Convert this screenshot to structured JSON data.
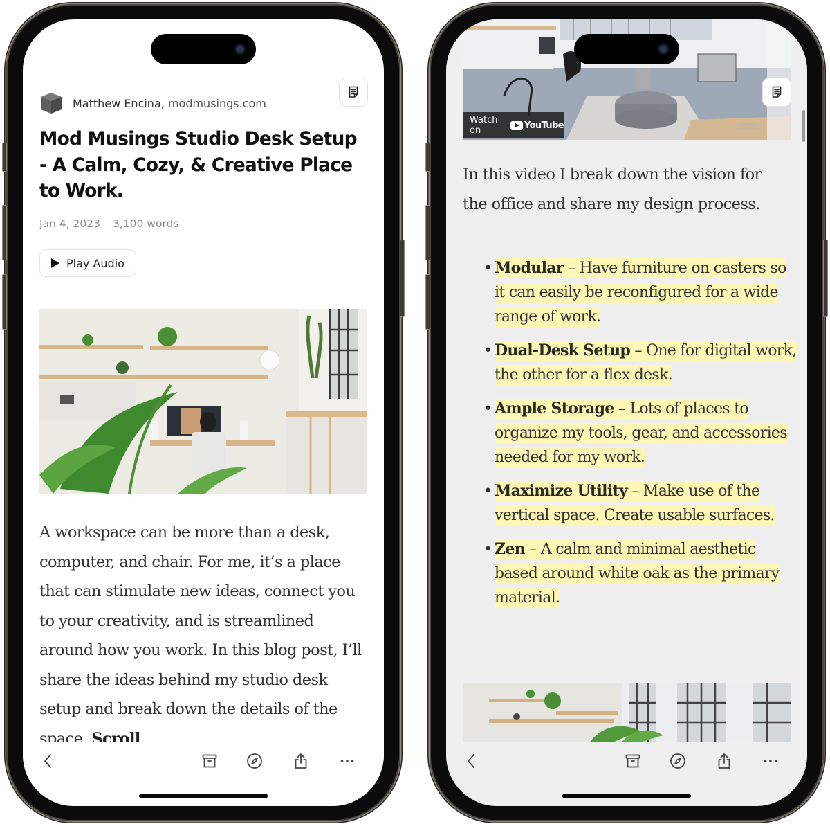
{
  "phones": [
    {
      "id": "left",
      "byline": {
        "author": "Matthew Encina,",
        "domain": "modmusings.com",
        "logo_icon": "gray-cube-icon"
      },
      "article": {
        "title": "Mod Musings Studio Desk Setup - A Calm, Cozy, & Creative Place to Work.",
        "date": "Jan 4, 2023",
        "word_count": "3,100 words",
        "play_audio_label": "Play Audio",
        "hero_image_alt": "Studio desk with plants, shelves, monitor and person seated",
        "body": "A workspace can be more than a desk, computer, and chair. For me, it’s a place that can stimulate new ideas, connect you to your creativity, and is streamlined around how you work. In this blog post, I’ll share the ideas behind my studio desk setup and break down the details of the space.",
        "body_bold_tail": "Scroll"
      },
      "notebook_icon": "notebook-icon",
      "toolbar": {
        "icons": [
          "back-chevron-icon",
          "archive-icon",
          "compass-icon",
          "share-icon",
          "more-icon"
        ]
      }
    },
    {
      "id": "right",
      "video": {
        "alt": "Office rendering with desks, chairs and round ottoman",
        "watch_on": "Watch on",
        "youtube_label": "YouTube"
      },
      "intro": "In this video I break down the vision for the office and share my design process.",
      "bullets": [
        {
          "term": "Modular",
          "text": " – Have furniture on casters so it can easily be reconfigured for a wide range of work."
        },
        {
          "term": "Dual-Desk Setup",
          "text": " – One for digital work, the other for a flex desk."
        },
        {
          "term": "Ample Storage",
          "text": " – Lots of places to organize my tools, gear, and accessories needed for my work."
        },
        {
          "term": "Maximize Utility",
          "text": " – Make use of the vertical space. Create usable surfaces."
        },
        {
          "term": "Zen",
          "text": " – A calm and minimal aesthetic based around white oak as the primary material."
        }
      ],
      "bullet_glyph": "•",
      "highlight_color": "#fdf6b5",
      "photo2_alt": "Studio with shelves, plants and large windows",
      "notebook_icon": "notebook-icon",
      "toolbar": {
        "icons": [
          "back-chevron-icon",
          "archive-icon",
          "compass-icon",
          "share-icon",
          "more-icon"
        ]
      }
    }
  ]
}
